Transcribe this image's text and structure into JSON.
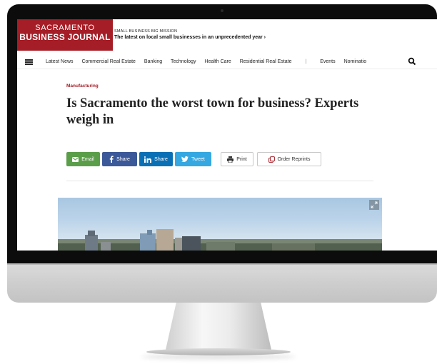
{
  "masthead": {
    "logo_line1": "SACRAMENTO",
    "logo_line2": "BUSINESS JOURNAL",
    "promo_kicker": "SMALL BUSINESS BIG MISSION",
    "promo_headline": "The latest on local small businesses in an unprecedented year ›"
  },
  "nav": {
    "items": [
      "Latest News",
      "Commercial Real Estate",
      "Banking",
      "Technology",
      "Health Care",
      "Residential Real Estate"
    ],
    "separator": "|",
    "extra_items": [
      "Events",
      "Nominatio"
    ]
  },
  "article": {
    "category": "Manufacturing",
    "headline": "Is Sacramento the worst town for business? Experts weigh in"
  },
  "share": {
    "email": "Email",
    "facebook": "Share",
    "linkedin": "Share",
    "twitter": "Tweet",
    "print": "Print",
    "reprints": "Order Reprints"
  },
  "colors": {
    "brand": "#a51d26",
    "email": "#5b9e4a",
    "facebook": "#3b5998",
    "linkedin": "#0a70b5",
    "twitter": "#35a8e1"
  },
  "icons": [
    "hamburger-icon",
    "search-icon",
    "envelope-icon",
    "facebook-icon",
    "linkedin-icon",
    "twitter-icon",
    "printer-icon",
    "reprints-icon",
    "expand-icon"
  ]
}
